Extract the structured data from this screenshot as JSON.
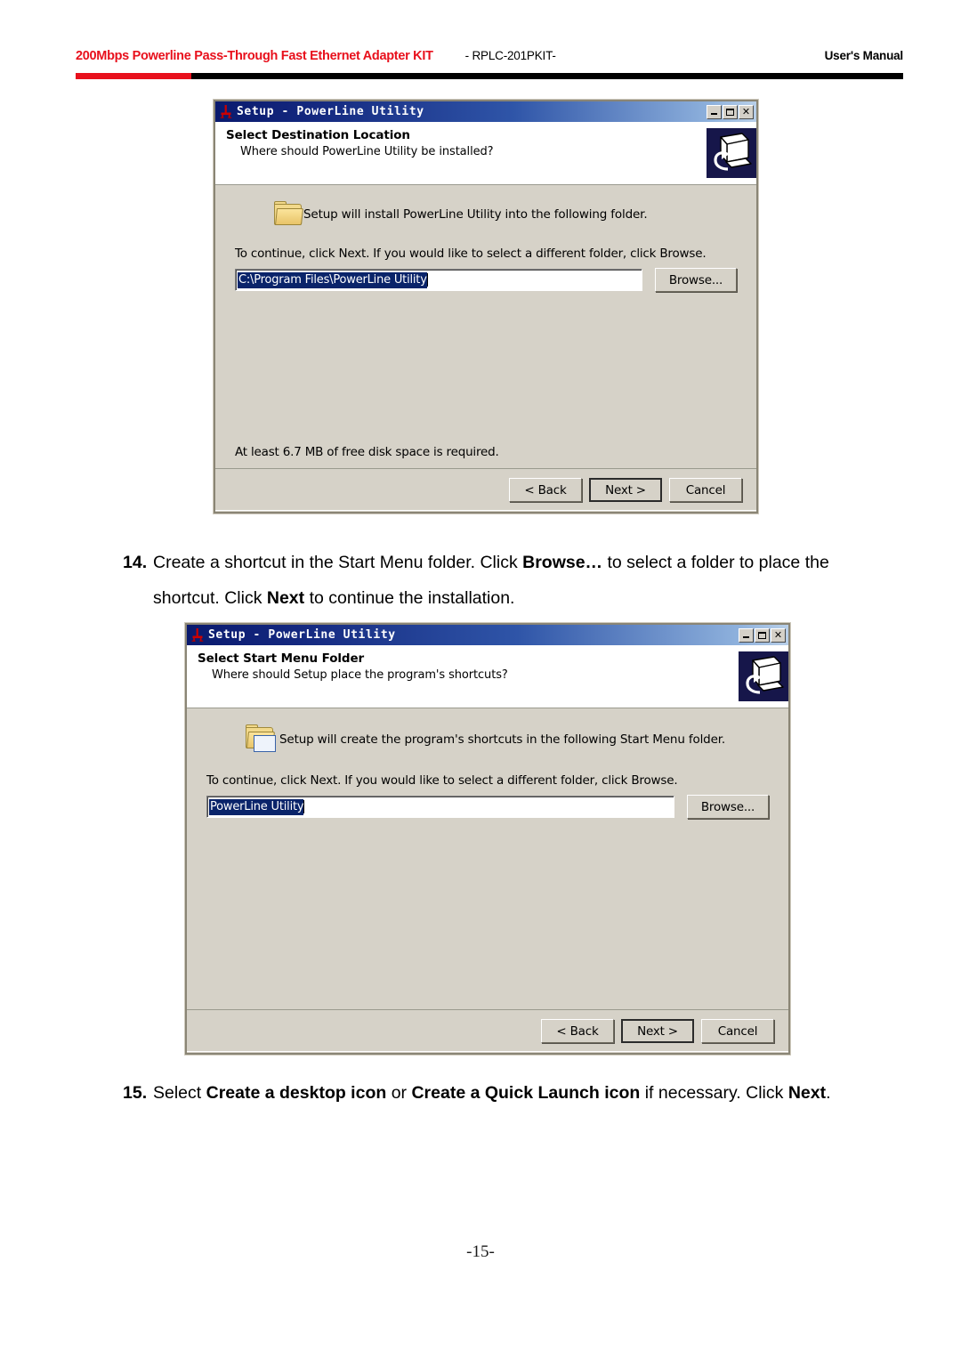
{
  "header": {
    "product_title": "200Mbps Powerline Pass-Through Fast Ethernet Adapter KIT",
    "model": "- RPLC-201PKIT-",
    "manual_label": "User's Manual",
    "rule_red_hex": "#e8101c",
    "rule_black_hex": "#000000"
  },
  "dialogs": [
    {
      "titlebar": {
        "title": "Setup - PowerLine Utility",
        "minimize_label": "_",
        "maximize_label": "□",
        "close_label": "✕",
        "icon_name": "setup-app-icon"
      },
      "head": {
        "heading": "Select Destination Location",
        "subheading": "Where should PowerLine Utility be installed?",
        "icon_name": "computer-install-icon"
      },
      "body": {
        "row_icon_name": "folder-icon",
        "row_text": "Setup will install PowerLine Utility into the following folder.",
        "note": "To continue, click Next. If you would like to select a different folder, click Browse.",
        "field_value": "C:\\Program Files\\PowerLine Utility",
        "browse_label": "Browse...",
        "disk_note": "At least 6.7 MB of free disk space is required."
      },
      "footer": {
        "back_label": "< Back",
        "next_label": "Next >",
        "cancel_label": "Cancel"
      }
    },
    {
      "titlebar": {
        "title": "Setup - PowerLine Utility",
        "minimize_label": "_",
        "maximize_label": "□",
        "close_label": "✕",
        "icon_name": "setup-app-icon"
      },
      "head": {
        "heading": "Select Start Menu Folder",
        "subheading": "Where should Setup place the program's shortcuts?",
        "icon_name": "computer-install-icon"
      },
      "body": {
        "row_icon_name": "folder-programs-icon",
        "row_text": "Setup will create the program's shortcuts in the following Start Menu folder.",
        "note": "To continue, click Next. If you would like to select a different folder, click Browse.",
        "field_value": "PowerLine Utility",
        "browse_label": "Browse...",
        "disk_note": ""
      },
      "footer": {
        "back_label": "< Back",
        "next_label": "Next >",
        "cancel_label": "Cancel"
      }
    }
  ],
  "steps": [
    {
      "number": "14.",
      "parts": [
        {
          "text": "Create a shortcut in the Start Menu folder. Click ",
          "bold": false
        },
        {
          "text": "Browse…",
          "bold": true
        },
        {
          "text": " to select a folder to place the shortcut. Click ",
          "bold": false
        },
        {
          "text": "Next",
          "bold": true
        },
        {
          "text": " to continue the installation.",
          "bold": false
        }
      ]
    },
    {
      "number": "15.",
      "parts": [
        {
          "text": "Select ",
          "bold": false
        },
        {
          "text": "Create a desktop icon",
          "bold": true
        },
        {
          "text": " or ",
          "bold": false
        },
        {
          "text": "Create a Quick Launch icon",
          "bold": true
        },
        {
          "text": " if necessary. Click ",
          "bold": false
        },
        {
          "text": "Next",
          "bold": true
        },
        {
          "text": ".",
          "bold": false
        }
      ]
    }
  ],
  "page_number": "-15-"
}
